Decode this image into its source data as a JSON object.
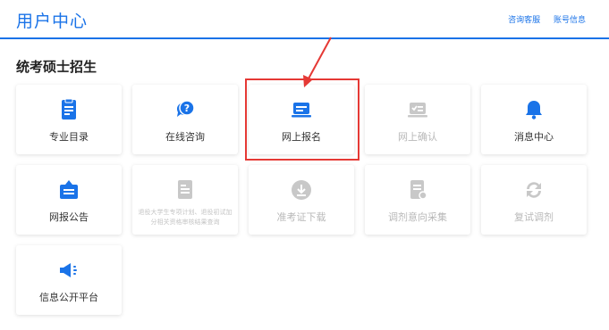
{
  "header": {
    "title": "用户中心",
    "links": [
      "咨询客服",
      "账号信息"
    ]
  },
  "section": {
    "title": "统考硕士招生"
  },
  "cards": [
    {
      "label": "专业目录",
      "icon": "document-icon",
      "enabled": true
    },
    {
      "label": "在线咨询",
      "icon": "chat-question-icon",
      "enabled": true
    },
    {
      "label": "网上报名",
      "icon": "laptop-icon",
      "enabled": true,
      "highlighted": true
    },
    {
      "label": "网上确认",
      "icon": "check-list-icon",
      "enabled": false
    },
    {
      "label": "消息中心",
      "icon": "bell-icon",
      "enabled": true
    },
    {
      "label": "网报公告",
      "icon": "announcement-icon",
      "enabled": true
    },
    {
      "label": "退役大学生专项计划、退役初试加分相关资格审核结果查询",
      "icon": "document-lines-icon",
      "enabled": false
    },
    {
      "label": "准考证下载",
      "icon": "download-icon",
      "enabled": false
    },
    {
      "label": "调剂意向采集",
      "icon": "form-icon",
      "enabled": false
    },
    {
      "label": "复试调剂",
      "icon": "refresh-icon",
      "enabled": false
    },
    {
      "label": "信息公开平台",
      "icon": "megaphone-icon",
      "enabled": true
    }
  ],
  "colors": {
    "accent": "#1a73e8",
    "disabled": "#c8c8c8",
    "highlight": "#e53935"
  }
}
